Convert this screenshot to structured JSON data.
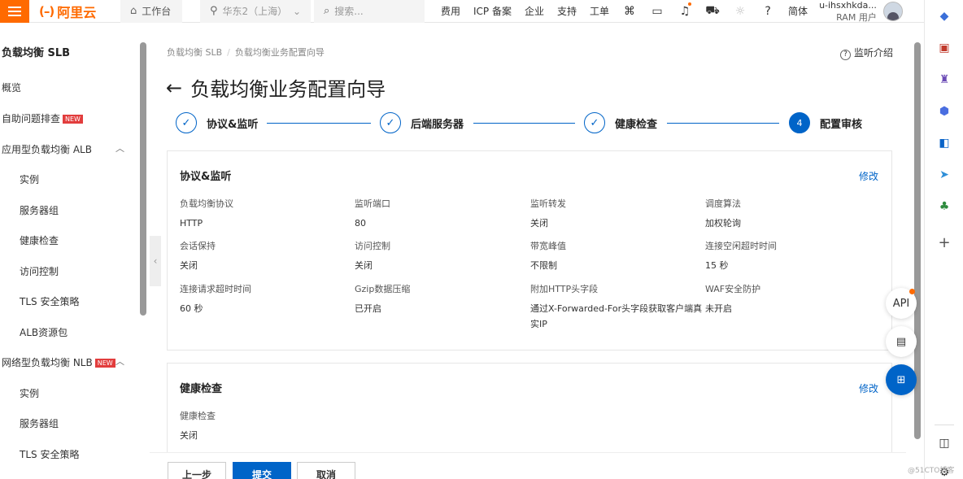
{
  "topbar": {
    "logo": "阿里云",
    "logo_mark": "(–)",
    "home": "工作台",
    "region": "华东2（上海）",
    "search_placeholder": "搜索...",
    "links": [
      "费用",
      "ICP 备案",
      "企业",
      "支持",
      "工单"
    ],
    "lang": "简体",
    "user_name": "u-ihsxhkda...",
    "user_role": "RAM 用户"
  },
  "sidebar": {
    "title": "负载均衡 SLB",
    "overview": "概览",
    "troubleshoot": "自助问题排查",
    "new_badge": "NEW",
    "alb_group": "应用型负载均衡 ALB",
    "alb_items": [
      "实例",
      "服务器组",
      "健康检查",
      "访问控制",
      "TLS 安全策略",
      "ALB资源包"
    ],
    "nlb_group": "网络型负载均衡 NLB",
    "nlb_items": [
      "实例",
      "服务器组",
      "TLS 安全策略"
    ]
  },
  "main": {
    "breadcrumb": [
      "负载均衡 SLB",
      "负载均衡业务配置向导"
    ],
    "intro": "监听介绍",
    "title": "负载均衡业务配置向导",
    "steps": [
      {
        "label": "协议&监听",
        "state": "done"
      },
      {
        "label": "后端服务器",
        "state": "done"
      },
      {
        "label": "健康检查",
        "state": "done"
      },
      {
        "label": "配置审核",
        "state": "active",
        "num": "4"
      }
    ],
    "protocol_card": {
      "title": "协议&监听",
      "edit": "修改",
      "fields": [
        {
          "k": "负载均衡协议",
          "v": "HTTP"
        },
        {
          "k": "监听端口",
          "v": "80"
        },
        {
          "k": "监听转发",
          "v": "关闭"
        },
        {
          "k": "调度算法",
          "v": "加权轮询"
        },
        {
          "k": "会话保持",
          "v": "关闭"
        },
        {
          "k": "访问控制",
          "v": "关闭"
        },
        {
          "k": "带宽峰值",
          "v": "不限制"
        },
        {
          "k": "连接空闲超时时间",
          "v": "15 秒"
        },
        {
          "k": "连接请求超时时间",
          "v": "60 秒"
        },
        {
          "k": "Gzip数据压缩",
          "v": "已开启"
        },
        {
          "k": "附加HTTP头字段",
          "v": "通过X-Forwarded-For头字段获取客户端真实IP"
        },
        {
          "k": "WAF安全防护",
          "v": "未开启"
        }
      ]
    },
    "health_card": {
      "title": "健康检查",
      "edit": "修改",
      "fields": [
        {
          "k": "健康检查",
          "v": "关闭"
        }
      ]
    }
  },
  "actions": {
    "prev": "上一步",
    "submit": "提交",
    "cancel": "取消"
  },
  "float": {
    "api": "API"
  },
  "watermark": "@51CTO博客"
}
